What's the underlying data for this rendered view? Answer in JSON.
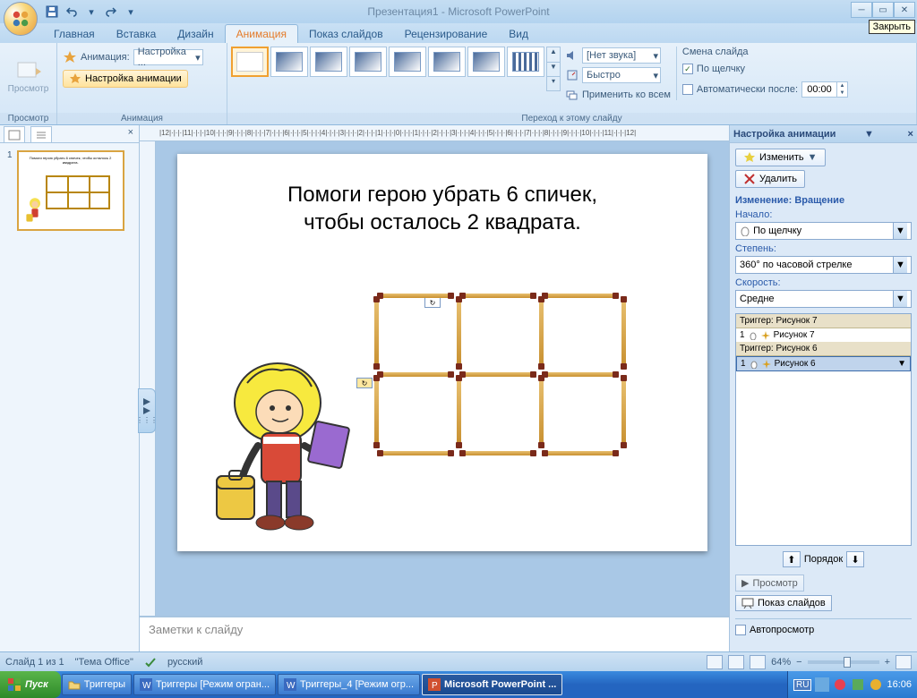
{
  "title": "Презентация1 - Microsoft PowerPoint",
  "close_tooltip": "Закрыть",
  "tabs": {
    "home": "Главная",
    "insert": "Вставка",
    "design": "Дизайн",
    "animation": "Анимация",
    "slideshow": "Показ слайдов",
    "review": "Рецензирование",
    "view": "Вид"
  },
  "ribbon": {
    "preview_btn": "Просмотр",
    "preview_group": "Просмотр",
    "anim_label": "Анимация:",
    "anim_value": "Настройка ...",
    "custom_anim_btn": "Настройка анимации",
    "anim_group": "Анимация",
    "sound_label": "[Нет звука]",
    "speed_label": "Быстро",
    "apply_all": "Применить ко всем",
    "advance_label": "Смена слайда",
    "on_click": "По щелчку",
    "auto_after": "Автоматически после:",
    "auto_time": "00:00",
    "transition_group": "Переход к этому слайду"
  },
  "slide": {
    "title_line1": "Помоги герою убрать 6 спичек,",
    "title_line2": "чтобы осталось 2 квадрата.",
    "notes_placeholder": "Заметки к слайду"
  },
  "ruler": "|12|·|·|·|11|·|·|·|10|·|·|·|9|·|·|·|8|·|·|·|7|·|·|·|6|·|·|·|5|·|·|·|4|·|·|·|3|·|·|·|2|·|·|·|1|·|·|·|0|·|·|·|1|·|·|·|2|·|·|·|3|·|·|·|4|·|·|·|5|·|·|·|6|·|·|·|7|·|·|·|8|·|·|·|9|·|·|·|10|·|·|·|11|·|·|·|12|",
  "taskpane": {
    "title": "Настройка анимации",
    "change_btn": "Изменить",
    "remove_btn": "Удалить",
    "effect_label": "Изменение: Вращение",
    "start_label": "Начало:",
    "start_value": "По щелчку",
    "amount_label": "Степень:",
    "amount_value": "360° по часовой стрелке",
    "speed_label": "Скорость:",
    "speed_value": "Средне",
    "trigger1": "Триггер: Рисунок 7",
    "item1_num": "1",
    "item1": "Рисунок 7",
    "trigger2": "Триггер: Рисунок 6",
    "item2_num": "1",
    "item2": "Рисунок 6",
    "reorder": "Порядок",
    "play": "Просмотр",
    "slideshow": "Показ слайдов",
    "autopreview": "Автопросмотр"
  },
  "status": {
    "slide": "Слайд 1 из 1",
    "theme": "\"Тема Office\"",
    "lang": "русский",
    "zoom": "64%"
  },
  "taskbar": {
    "start": "Пуск",
    "item1": "Триггеры",
    "item2": "Триггеры [Режим огран...",
    "item3": "Триггеры_4 [Режим огр...",
    "item4": "Microsoft PowerPoint ...",
    "lang": "RU",
    "time": "16:06"
  }
}
